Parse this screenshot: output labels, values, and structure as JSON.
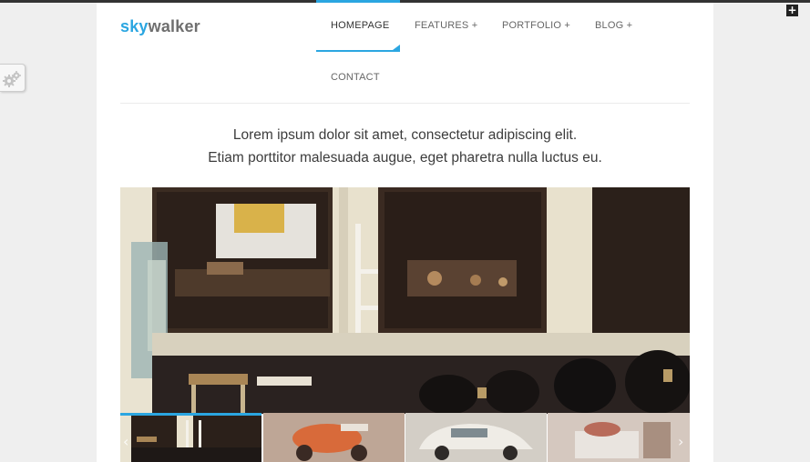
{
  "logo": {
    "part_a": "sky",
    "part_b": "walker"
  },
  "nav": {
    "items": [
      {
        "label": "HOMEPAGE"
      },
      {
        "label": "FEATURES +"
      },
      {
        "label": "PORTFOLIO +"
      },
      {
        "label": "BLOG +"
      },
      {
        "label": "CONTACT"
      }
    ],
    "active_index": 0
  },
  "intro": {
    "line1": "Lorem ipsum dolor sit amet, consectetur adipiscing elit.",
    "line2": "Etiam porttitor malesuada augue, eget pharetra nulla luctus eu."
  },
  "controls": {
    "plus_icon": "+",
    "prev_arrow": "‹",
    "next_arrow": "›"
  },
  "colors": {
    "accent": "#2ba6e1",
    "logo_gray": "#6f6f6f",
    "top_bar": "#333333"
  }
}
